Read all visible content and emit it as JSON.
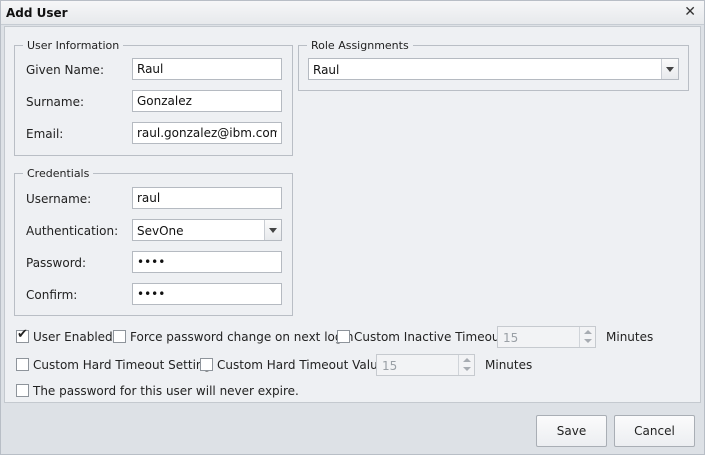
{
  "dialog": {
    "title": "Add User",
    "close_icon": "close-icon"
  },
  "user_info": {
    "legend": "User Information",
    "given_name_label": "Given Name:",
    "given_name_value": "Raul",
    "surname_label": "Surname:",
    "surname_value": "Gonzalez",
    "email_label": "Email:",
    "email_value": "raul.gonzalez@ibm.com"
  },
  "role_assignments": {
    "legend": "Role Assignments",
    "selected_value": "Raul"
  },
  "credentials": {
    "legend": "Credentials",
    "username_label": "Username:",
    "username_value": "raul",
    "authentication_label": "Authentication:",
    "authentication_value": "SevOne",
    "password_label": "Password:",
    "password_value": "••••",
    "confirm_label": "Confirm:",
    "confirm_value": "••••"
  },
  "options": {
    "user_enabled_label": "User Enabled",
    "user_enabled_checked": true,
    "force_password_label": "Force password change on next login",
    "force_password_checked": false,
    "custom_inactive_label": "Custom Inactive Timeout",
    "custom_inactive_checked": false,
    "inactive_timeout_value": "15",
    "inactive_minutes_label": "Minutes",
    "custom_hard_setting_label": "Custom Hard Timeout Setting",
    "custom_hard_setting_checked": false,
    "custom_hard_value_label": "Custom Hard Timeout Value",
    "custom_hard_value_checked": false,
    "hard_timeout_value": "15",
    "hard_minutes_label": "Minutes",
    "never_expire_label": "The password for this user will never expire.",
    "never_expire_checked": false
  },
  "footer": {
    "save_label": "Save",
    "cancel_label": "Cancel"
  }
}
